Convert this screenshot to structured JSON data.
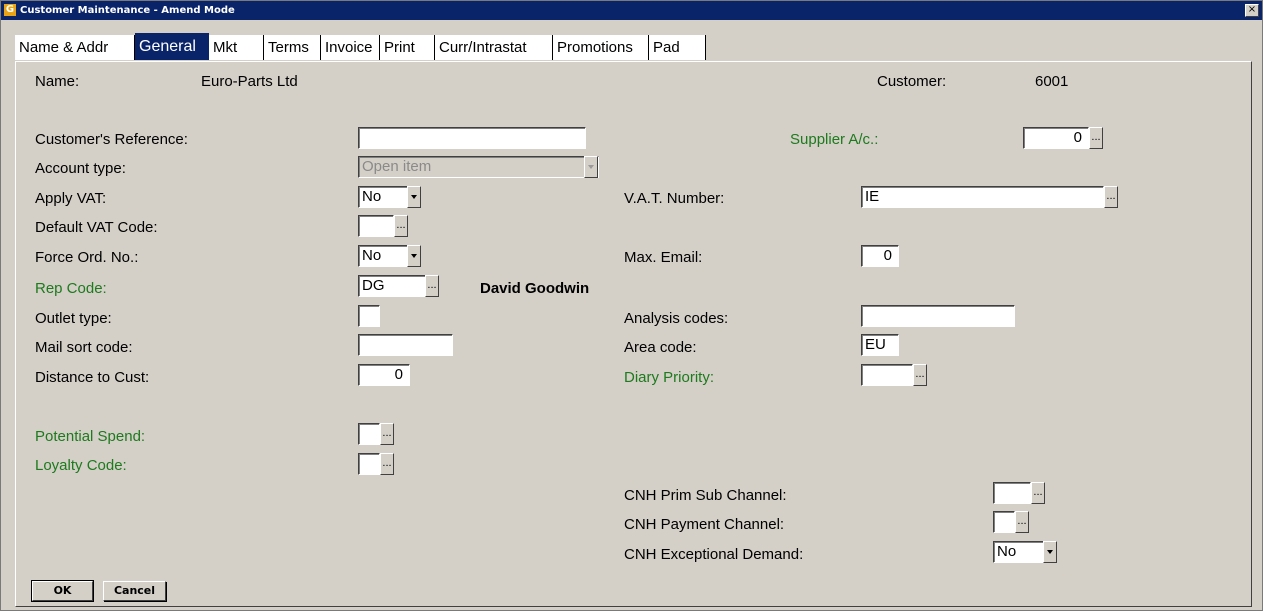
{
  "window": {
    "title": "Customer Maintenance - Amend Mode",
    "icon": "G",
    "close": "×"
  },
  "tabs": [
    {
      "label": "Name & Addr",
      "active": false
    },
    {
      "label": "General",
      "active": true
    },
    {
      "label": "Mkt",
      "active": false
    },
    {
      "label": "Terms",
      "active": false
    },
    {
      "label": "Invoice",
      "active": false
    },
    {
      "label": "Print",
      "active": false
    },
    {
      "label": "Curr/Intrastat",
      "active": false
    },
    {
      "label": "Promotions",
      "active": false
    },
    {
      "label": "Pad",
      "active": false
    }
  ],
  "header": {
    "name_label": "Name:",
    "name_value": "Euro-Parts Ltd",
    "customer_label": "Customer:",
    "customer_value": "6001"
  },
  "left": {
    "customers_reference": {
      "label": "Customer's Reference:",
      "value": ""
    },
    "account_type": {
      "label": "Account type:",
      "value": "Open item"
    },
    "apply_vat": {
      "label": "Apply VAT:",
      "value": "No"
    },
    "default_vat_code": {
      "label": "Default VAT Code:",
      "value": ""
    },
    "force_ord_no": {
      "label": "Force Ord. No.:",
      "value": "No"
    },
    "rep_code": {
      "label": "Rep Code:",
      "value": "DG",
      "rep_name": "David Goodwin"
    },
    "outlet_type": {
      "label": "Outlet type:",
      "value": ""
    },
    "mail_sort_code": {
      "label": "Mail sort code:",
      "value": ""
    },
    "distance_to_cust": {
      "label": "Distance to Cust:",
      "value": "0"
    },
    "potential_spend": {
      "label": "Potential Spend:",
      "value": ""
    },
    "loyalty_code": {
      "label": "Loyalty Code:",
      "value": ""
    }
  },
  "right": {
    "supplier_ac": {
      "label": "Supplier A/c.:",
      "value": "0"
    },
    "vat_number": {
      "label": "V.A.T. Number:",
      "value": "IE"
    },
    "max_email": {
      "label": "Max. Email:",
      "value": "0"
    },
    "analysis_codes": {
      "label": "Analysis codes:",
      "value": ""
    },
    "area_code": {
      "label": "Area code:",
      "value": "EU"
    },
    "diary_priority": {
      "label": "Diary Priority:",
      "value": ""
    },
    "cnh_prim_sub_channel": {
      "label": "CNH Prim Sub Channel:",
      "value": ""
    },
    "cnh_payment_channel": {
      "label": "CNH Payment Channel:",
      "value": ""
    },
    "cnh_exceptional_demand": {
      "label": "CNH Exceptional Demand:",
      "value": "No"
    }
  },
  "buttons": {
    "ok": "OK",
    "cancel": "Cancel",
    "lookup": "..."
  },
  "colors": {
    "titlebar": "#0a246a",
    "accent_label": "#1d7a1d",
    "face": "#d4d0c8"
  }
}
